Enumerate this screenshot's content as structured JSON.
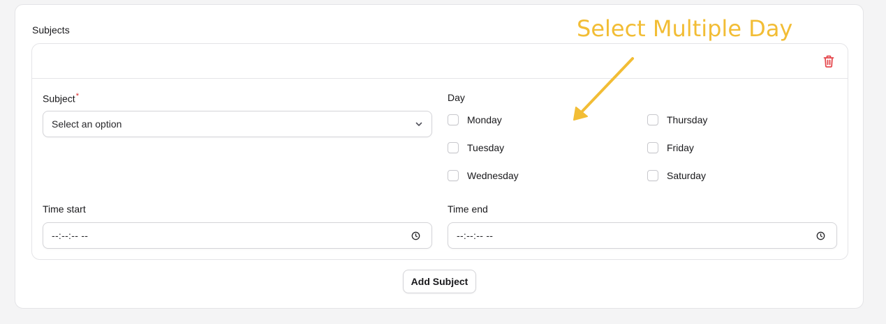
{
  "section": {
    "label": "Subjects"
  },
  "subject_field": {
    "label": "Subject",
    "required_mark": "*",
    "placeholder": "Select an option"
  },
  "day_field": {
    "label": "Day",
    "options": [
      "Monday",
      "Tuesday",
      "Wednesday",
      "Thursday",
      "Friday",
      "Saturday"
    ]
  },
  "time_start": {
    "label": "Time start",
    "value": "--:--:-- --"
  },
  "time_end": {
    "label": "Time end",
    "value": "--:--:-- --"
  },
  "add_button": {
    "label": "Add Subject"
  },
  "annotation": {
    "text": "Select Multiple Day"
  },
  "colors": {
    "delete_icon": "#e5484d",
    "annotation": "#f2bd35",
    "required": "#dc2626",
    "border": "#e4e4e7"
  },
  "icons": {
    "delete": "trash-icon",
    "select": "chevron-down-icon",
    "time": "clock-icon"
  }
}
